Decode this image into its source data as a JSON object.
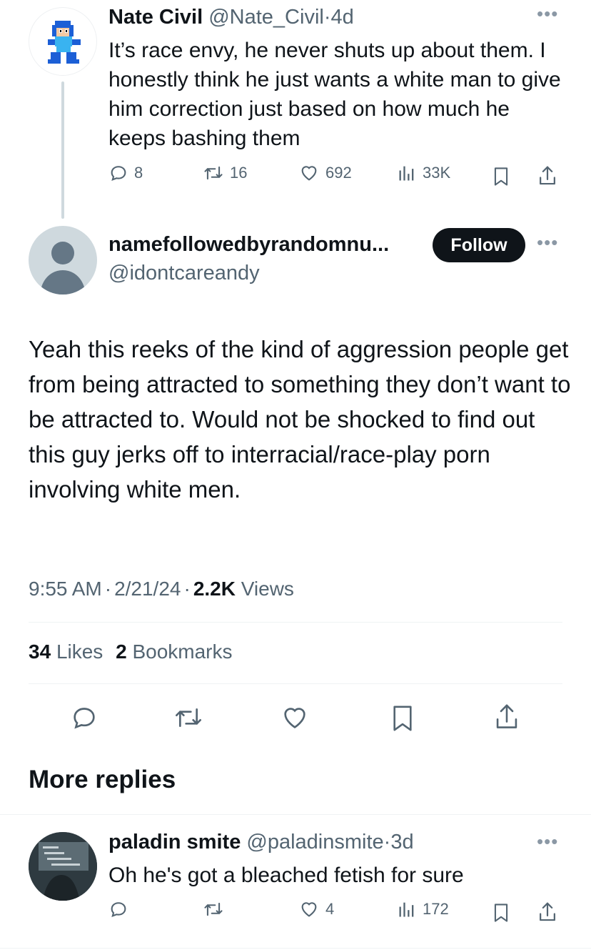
{
  "parent_reply": {
    "author_name": "Nate Civil",
    "handle": "@Nate_Civil",
    "sep": "·",
    "age": "4d",
    "text": "It’s race envy, he never shuts up about them. I honestly think he just wants a white man to give him correction just based on how much he keeps bashing them",
    "replies": "8",
    "reposts": "16",
    "likes": "692",
    "views": "33K"
  },
  "main_tweet": {
    "author_name": "namefollowedbyrandomnu...",
    "handle": "@idontcareandy",
    "follow_label": "Follow",
    "text": "Yeah this reeks of the kind of aggression people get from being attracted to something they don’t want to be attracted to. Would not be shocked to find out this guy jerks off to interracial/race-play porn involving white men.",
    "time": "9:55 AM",
    "date": "2/21/24",
    "dot1": "·",
    "dot2": "·",
    "views_count": "2.2K",
    "views_label": "Views",
    "likes_count": "34",
    "likes_label": "Likes",
    "bookmarks_count": "2",
    "bookmarks_label": "Bookmarks"
  },
  "more_replies_heading": "More replies",
  "reply": {
    "author_name": "paladin smite",
    "handle": "@paladinsmite",
    "sep": "·",
    "age": "3d",
    "text": "Oh he's got a bleached fetish for sure",
    "replies": "",
    "reposts": "",
    "likes": "4",
    "views": "172"
  },
  "colors": {
    "text": "#0f1419",
    "muted": "#536471",
    "divider": "#eff3f4",
    "follow_bg": "#0f1419"
  },
  "icons": [
    "mega-man-avatar",
    "default-avatar",
    "reply-icon",
    "repost-icon",
    "like-icon",
    "views-icon",
    "bookmark-icon",
    "share-icon",
    "more-icon"
  ]
}
